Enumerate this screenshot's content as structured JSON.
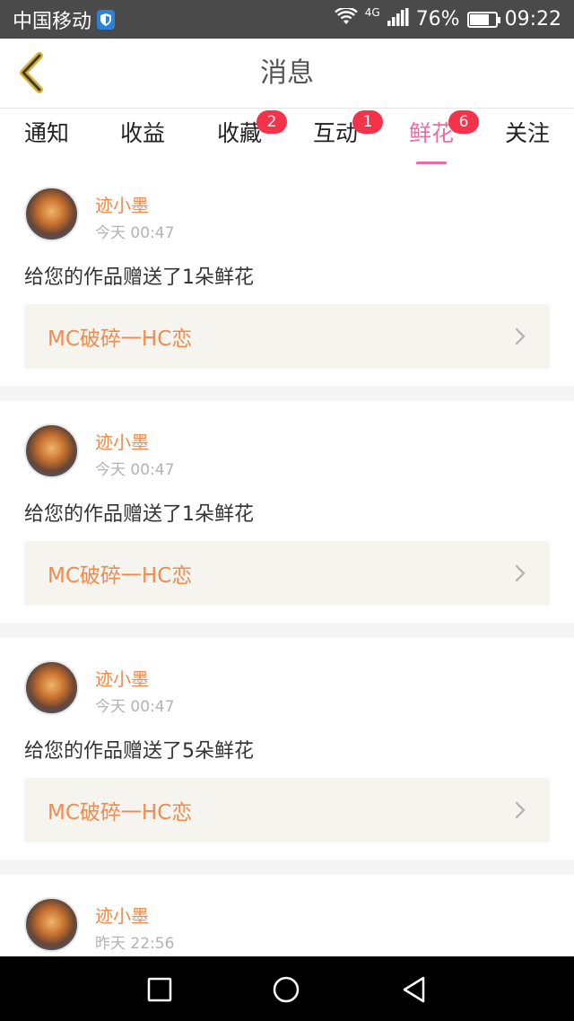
{
  "status_bar": {
    "carrier": "中国移动",
    "network": "4G",
    "battery_text": "76%",
    "battery_level": 0.76,
    "time": "09:22"
  },
  "header": {
    "title": "消息",
    "back_icon": "chevron-left-icon"
  },
  "tabs": [
    {
      "label": "通知",
      "badge": ""
    },
    {
      "label": "收益",
      "badge": ""
    },
    {
      "label": "收藏",
      "badge": "2"
    },
    {
      "label": "互动",
      "badge": "1"
    },
    {
      "label": "鲜花",
      "badge": "6",
      "active": true
    },
    {
      "label": "关注",
      "badge": ""
    }
  ],
  "messages": [
    {
      "user": "迹小墨",
      "time": "今天 00:47",
      "text": "给您的作品赠送了1朵鲜花",
      "work": "MC破碎一HC恋"
    },
    {
      "user": "迹小墨",
      "time": "今天 00:47",
      "text": "给您的作品赠送了1朵鲜花",
      "work": "MC破碎一HC恋"
    },
    {
      "user": "迹小墨",
      "time": "今天 00:47",
      "text": "给您的作品赠送了5朵鲜花",
      "work": "MC破碎一HC恋"
    },
    {
      "user": "迹小墨",
      "time": "昨天 22:56"
    }
  ],
  "colors": {
    "accent": "#e86ea3",
    "username": "#f08b4f",
    "badge": "#f2334a"
  }
}
